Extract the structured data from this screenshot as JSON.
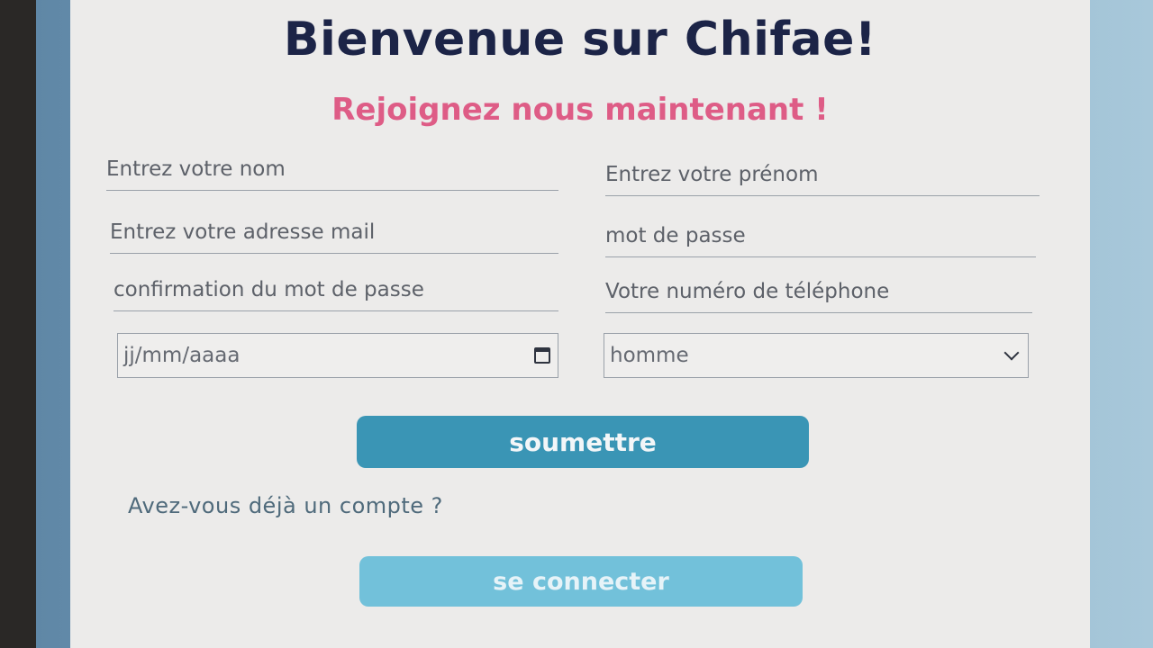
{
  "form": {
    "title": "Bienvenue sur Chifae!",
    "subtitle": "Rejoignez nous maintenant !",
    "fields": {
      "nom": {
        "placeholder": "Entrez votre nom"
      },
      "prenom": {
        "placeholder": "Entrez votre prénom"
      },
      "email": {
        "placeholder": "Entrez votre adresse mail"
      },
      "password": {
        "placeholder": "mot de passe"
      },
      "password_confirm": {
        "placeholder": "confirmation du mot de passe"
      },
      "telephone": {
        "placeholder": "Votre numéro de téléphone"
      },
      "birthdate": {
        "placeholder": "jj/mm/aaaa"
      },
      "gender": {
        "selected": "homme"
      }
    },
    "submit_label": "soumettre",
    "have_account_text": "Avez-vous déjà un compte ?",
    "login_label": "se connecter"
  },
  "colors": {
    "title": "#1c2447",
    "subtitle": "#de5c86",
    "submit_button": "#3a95b5",
    "login_button": "#72c1da",
    "card_background": "#ecebea"
  },
  "icons": {
    "date_field": "calendar-icon",
    "gender_select": "chevron-down-icon"
  }
}
